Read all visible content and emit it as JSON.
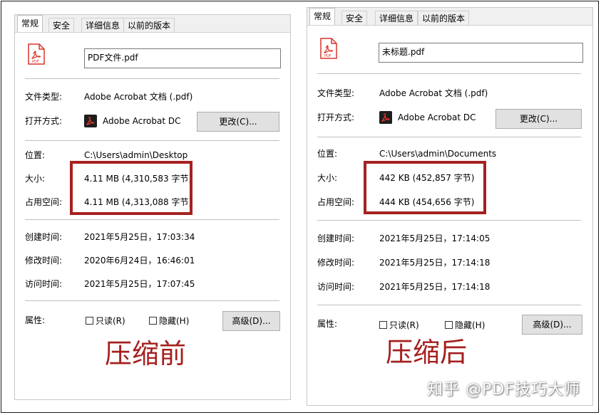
{
  "tabs": [
    "常规",
    "安全",
    "详细信息",
    "以前的版本"
  ],
  "labels": {
    "file_type": "文件类型:",
    "open_with": "打开方式:",
    "location": "位置:",
    "size": "大小:",
    "size_on_disk": "占用空间:",
    "created": "创建时间:",
    "modified": "修改时间:",
    "accessed": "访问时间:",
    "attributes": "属性:",
    "readonly": "只读(R)",
    "hidden": "隐藏(H)",
    "change_button": "更改(C)...",
    "advanced_button": "高级(D)..."
  },
  "left": {
    "filename": "PDF文件.pdf",
    "file_type": "Adobe Acrobat 文档 (.pdf)",
    "open_with": "Adobe Acrobat DC",
    "location": "C:\\Users\\admin\\Desktop",
    "size": "4.11 MB (4,310,583 字节)",
    "size_on_disk": "4.11 MB (4,313,088 字节)",
    "created": "2021年5月25日，17:03:34",
    "modified": "2020年6月24日，16:46:01",
    "accessed": "2021年5月25日，17:07:45",
    "caption": "压缩前"
  },
  "right": {
    "filename": "未标题.pdf",
    "file_type": "Adobe Acrobat 文档 (.pdf)",
    "open_with": "Adobe Acrobat DC",
    "location": "C:\\Users\\admin\\Documents",
    "size": "442 KB (452,857 字节)",
    "size_on_disk": "444 KB (454,656 字节)",
    "created": "2021年5月25日，17:14:05",
    "modified": "2021年5月25日，17:14:18",
    "accessed": "2021年5月25日，17:14:18",
    "caption": "压缩后"
  },
  "watermark": "知乎 @PDF技巧大师",
  "colors": {
    "highlight": "#a52121",
    "caption": "#a5201f",
    "pdf_red": "#d9352c"
  }
}
